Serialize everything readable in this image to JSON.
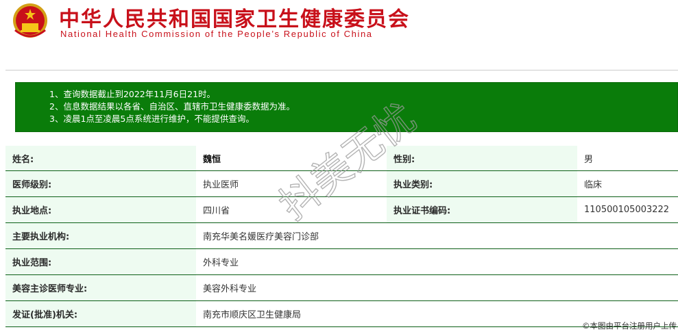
{
  "header": {
    "title_cn": "中华人民共和国国家卫生健康委员会",
    "title_en": "National Health Commission of the People’s Republic of China"
  },
  "notice": {
    "lines": [
      "1、查询数据截止到2022年11月6日21时。",
      "2、信息数据结果以各省、自治区、直辖市卫生健康委数据为准。",
      "3、凌晨1点至凌晨5点系统进行维护，不能提供查询。"
    ]
  },
  "record": {
    "name_label": "姓名:",
    "name_value": "魏恒",
    "gender_label": "性别:",
    "gender_value": "男",
    "level_label": "医师级别:",
    "level_value": "执业医师",
    "category_label": "执业类别:",
    "category_value": "临床",
    "location_label": "执业地点:",
    "location_value": "四川省",
    "cert_label": "执业证书编码:",
    "cert_value": "110500105003222",
    "institution_label": "主要执业机构:",
    "institution_value": "南充华美名媛医疗美容门诊部",
    "scope_label": "执业范围:",
    "scope_value": "外科专业",
    "cosmetic_label": "美容主诊医师专业:",
    "cosmetic_value": "美容外科专业",
    "issuer_label": "发证(批准)机关:",
    "issuer_value": "南充市顺庆区卫生健康局"
  },
  "watermark": {
    "text": "抖美无忧"
  },
  "credit": {
    "text": "©本图由平台注册用户上传"
  },
  "colors": {
    "brand_red": "#c8101a",
    "notice_green": "#0a7c0a",
    "label_bg": "#eefbf1",
    "row_border": "#0b5e16"
  }
}
